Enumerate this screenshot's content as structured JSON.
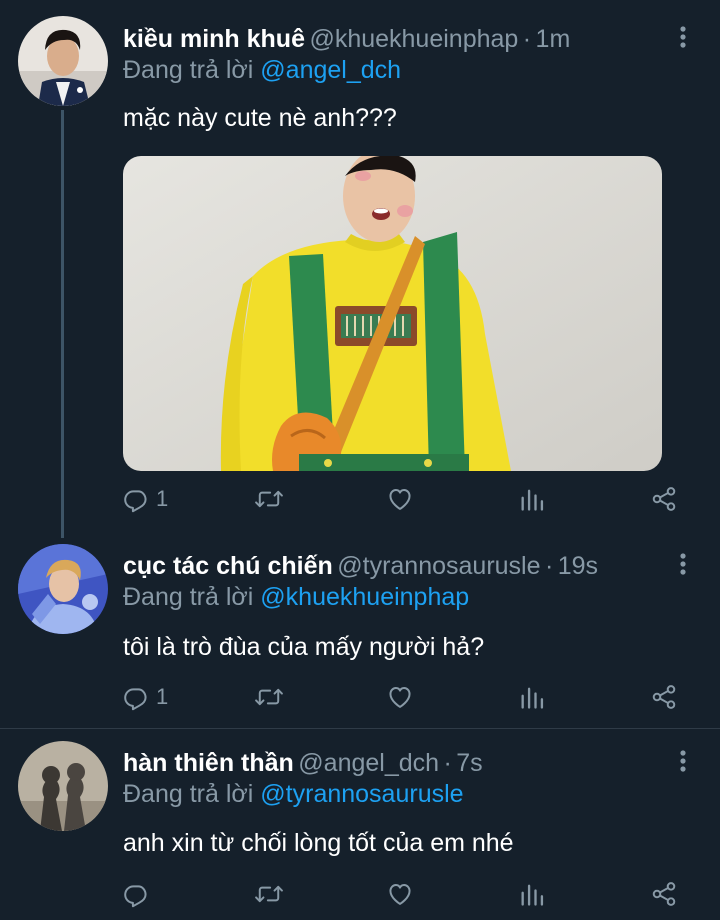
{
  "tweets": [
    {
      "name": "kiều minh khuê",
      "handle": "@khuekhueinphap",
      "separator": "·",
      "time": "1m",
      "reply_prefix": "Đang trả lời",
      "reply_to": "@angel_dch",
      "text": "mặc này cute nè anh???",
      "reply_count": "1",
      "retweet_count": "",
      "like_count": ""
    },
    {
      "name": "cục tác chú chiến",
      "handle": "@tyrannosaurusle",
      "separator": "·",
      "time": "19s",
      "reply_prefix": "Đang trả lời",
      "reply_to": "@khuekhueinphap",
      "text": "tôi là trò đùa của mấy người hả?",
      "reply_count": "1",
      "retweet_count": "",
      "like_count": ""
    },
    {
      "name": "hàn thiên thần",
      "handle": "@angel_dch",
      "separator": "·",
      "time": "7s",
      "reply_prefix": "Đang trả lời",
      "reply_to": "@tyrannosaurusle",
      "text": "anh xin từ chối lòng tốt của em nhé",
      "reply_count": "",
      "retweet_count": "",
      "like_count": ""
    }
  ],
  "icons": {
    "reply": "reply-icon",
    "retweet": "retweet-icon",
    "like": "heart-icon",
    "analytics": "analytics-icon",
    "share": "share-icon",
    "more": "more-vertical-icon"
  },
  "colors": {
    "background": "#15202b",
    "text_primary": "#ffffff",
    "text_secondary": "#8899a6",
    "link": "#1da1f2",
    "thread_line": "#3d5466"
  }
}
